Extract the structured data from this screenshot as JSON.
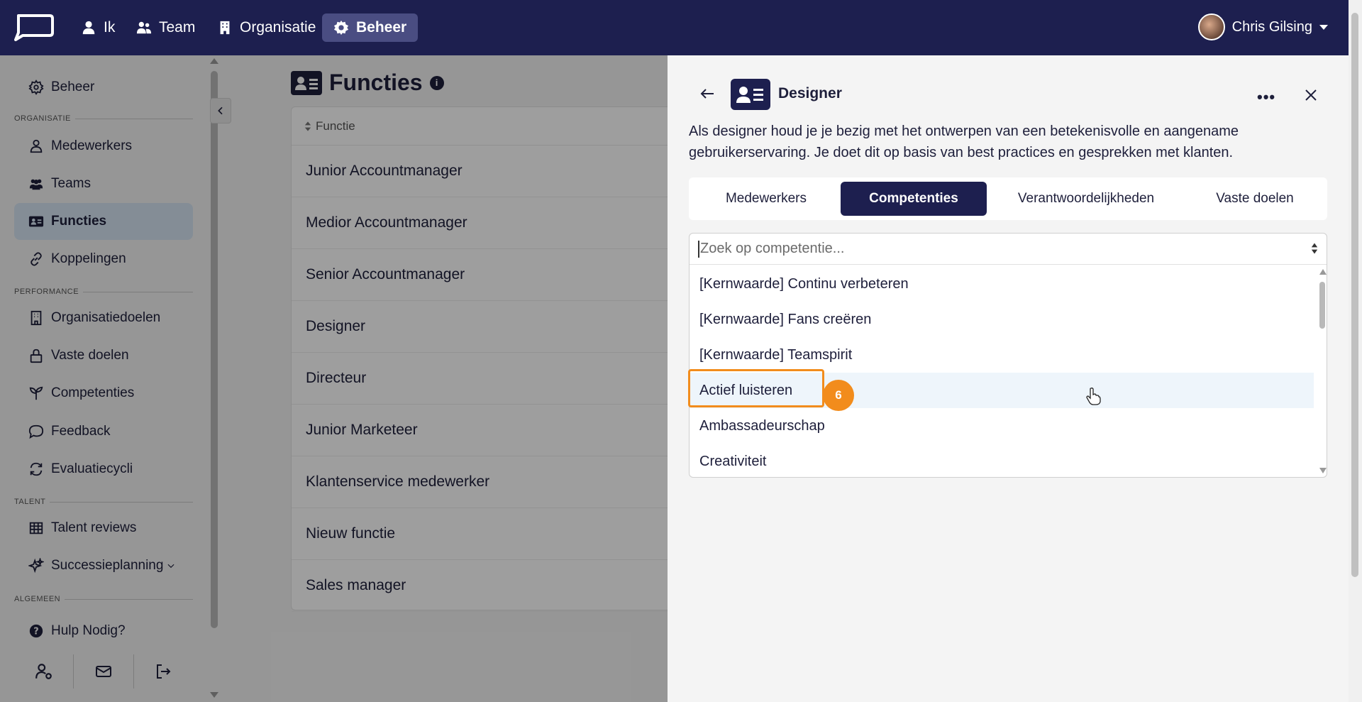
{
  "nav": {
    "items": [
      {
        "label": "Ik",
        "icon": "user-icon"
      },
      {
        "label": "Team",
        "icon": "users-icon"
      },
      {
        "label": "Organisatie",
        "icon": "building-icon"
      },
      {
        "label": "Beheer",
        "icon": "gear-icon",
        "active": true
      }
    ],
    "user_name": "Chris Gilsing"
  },
  "sidebar": {
    "top_item": "Beheer",
    "sections": [
      {
        "title": "ORGANISATIE",
        "items": [
          "Medewerkers",
          "Teams",
          "Functies",
          "Koppelingen"
        ]
      },
      {
        "title": "PERFORMANCE",
        "items": [
          "Organisatiedoelen",
          "Vaste doelen",
          "Competenties",
          "Feedback",
          "Evaluatiecycli"
        ]
      },
      {
        "title": "TALENT",
        "items": [
          "Talent reviews",
          "Successieplanning"
        ]
      },
      {
        "title": "ALGEMEEN",
        "items": [
          "Hulp Nodig?"
        ]
      }
    ],
    "active_item": "Functies"
  },
  "main": {
    "title": "Functies",
    "table_header": "Functie",
    "rows": [
      "Junior Accountmanager",
      "Medior Accountmanager",
      "Senior Accountmanager",
      "Designer",
      "Directeur",
      "Junior Marketeer",
      "Klantenservice medewerker",
      "Nieuw functie",
      "Sales manager"
    ]
  },
  "panel": {
    "title": "Designer",
    "description": "Als designer houd je je bezig met het ontwerpen van een betekenisvolle en aangename gebruikerservaring. Je doet dit op basis van best practices en gesprekken met klanten.",
    "tabs": [
      "Medewerkers",
      "Competenties",
      "Verantwoordelijkheden",
      "Vaste doelen"
    ],
    "active_tab": "Competenties",
    "search_placeholder": "Zoek op competentie...",
    "options": [
      "[Kernwaarde] Continu verbeteren",
      "[Kernwaarde] Fans creëren",
      "[Kernwaarde] Teamspirit",
      "Actief luisteren",
      "Ambassadeurschap",
      "Creativiteit"
    ],
    "hovered_option": "Actief luisteren",
    "step_badge": "6"
  },
  "colors": {
    "nav_bg": "#1d1f4f",
    "accent": "#f28c1c",
    "active_sidebar": "#d6e4f3"
  }
}
